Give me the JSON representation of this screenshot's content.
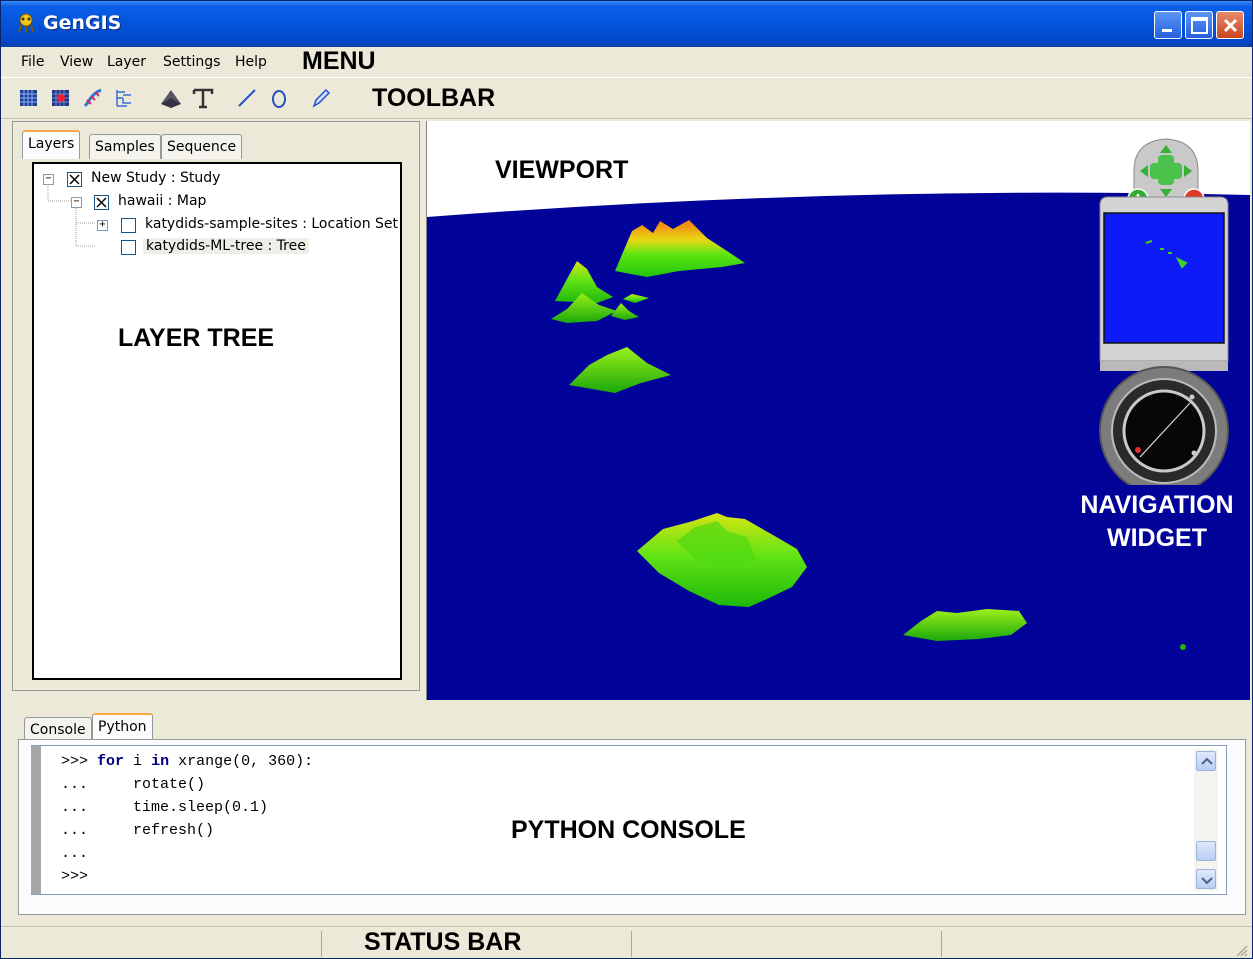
{
  "window": {
    "title": "GenGIS"
  },
  "menu": {
    "items": [
      "File",
      "View",
      "Layer",
      "Settings",
      "Help"
    ]
  },
  "callouts": {
    "menu": "MENU",
    "toolbar": "TOOLBAR",
    "viewport": "VIEWPORT",
    "layer_tree": "LAYER TREE",
    "navigation_line1": "NAVIGATION",
    "navigation_line2": "WIDGET",
    "python_console": "PYTHON CONSOLE",
    "status_bar": "STATUS BAR"
  },
  "toolbar": {
    "icons": [
      "open-map-icon",
      "open-location-icon",
      "open-sequence-icon",
      "open-tree-icon",
      "terrain-icon",
      "text-icon",
      "line-icon",
      "circle-icon",
      "pencil-icon"
    ]
  },
  "left_tabs": [
    "Layers",
    "Samples",
    "Sequence"
  ],
  "tree": {
    "items": [
      {
        "label": "New Study : Study",
        "checked": true
      },
      {
        "label": "hawaii : Map",
        "checked": true
      },
      {
        "label": "katydids-sample-sites : Location Set",
        "checked": false
      },
      {
        "label": "katydids-ML-tree : Tree",
        "checked": false
      }
    ]
  },
  "console": {
    "tabs": [
      "Console",
      "Python"
    ],
    "lines": [
      {
        "prompt": ">>>",
        "keyword1": "for",
        "mid1": " i ",
        "keyword2": "in",
        "rest": " xrange(0, 360):"
      },
      {
        "prompt": "...",
        "text": "    rotate()"
      },
      {
        "prompt": "...",
        "text": "    time.sleep(0.1)"
      },
      {
        "prompt": "...",
        "text": "    refresh()"
      },
      {
        "prompt": "...",
        "text": ""
      },
      {
        "prompt": ">>>",
        "text": ""
      }
    ]
  },
  "colors": {
    "ocean": "#020399",
    "land": "#33d411",
    "peak": "#f59a10"
  }
}
